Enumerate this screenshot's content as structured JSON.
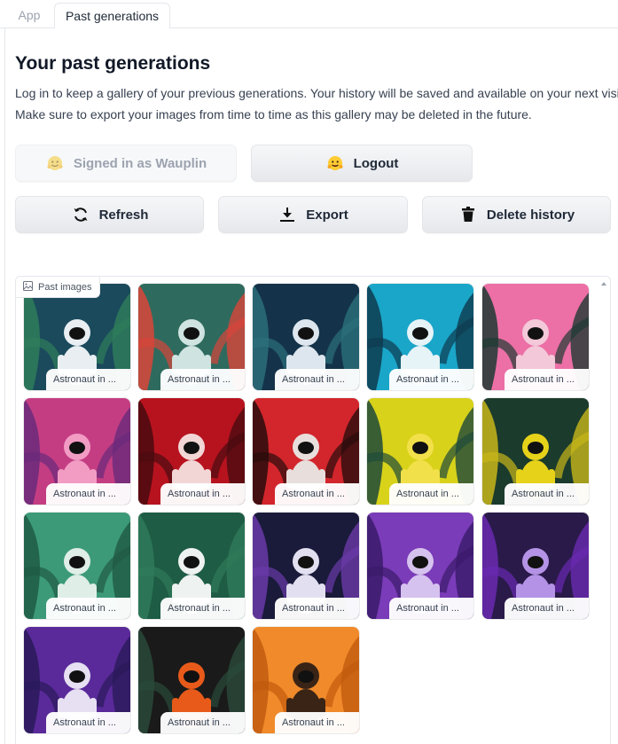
{
  "tabs": [
    {
      "label": "App"
    },
    {
      "label": "Past generations"
    }
  ],
  "page": {
    "title": "Your past generations",
    "description_line1": "Log in to keep a gallery of your previous generations. Your history will be saved and available on your next visit.",
    "description_line2": "Make sure to export your images from time to time as this gallery may be deleted in the future."
  },
  "buttons": {
    "signed_in": {
      "label": "Signed in as Wauplin",
      "icon": "hugging-face-icon"
    },
    "logout": {
      "label": "Logout",
      "icon": "hugging-face-icon"
    },
    "refresh": {
      "label": "Refresh",
      "icon": "refresh-icon"
    },
    "export": {
      "label": "Export",
      "icon": "download-icon"
    },
    "delete": {
      "label": "Delete history",
      "icon": "trash-icon"
    }
  },
  "gallery": {
    "label": "Past images",
    "icon": "image-icon",
    "items": [
      {
        "caption": "Astronaut in ...",
        "bg": "#1a4a5c",
        "accent": "#e8eef2",
        "leaf": "#2f7d5a"
      },
      {
        "caption": "Astronaut in ...",
        "bg": "#2e6b5e",
        "accent": "#cfe3e0",
        "leaf": "#d9453a"
      },
      {
        "caption": "Astronaut in ...",
        "bg": "#14334a",
        "accent": "#dde6ee",
        "leaf": "#2b6f7a"
      },
      {
        "caption": "Astronaut in ...",
        "bg": "#1aa6c9",
        "accent": "#e6f3f7",
        "leaf": "#0e3b4f"
      },
      {
        "caption": "Astronaut in ...",
        "bg": "#ec6fa6",
        "accent": "#f3c8d8",
        "leaf": "#1f3a33"
      },
      {
        "caption": "Astronaut in ...",
        "bg": "#c43d83",
        "accent": "#f29cc4",
        "leaf": "#6a2a7a"
      },
      {
        "caption": "Astronaut in ...",
        "bg": "#b7131f",
        "accent": "#f2d6d6",
        "leaf": "#4a0b0f"
      },
      {
        "caption": "Astronaut in ...",
        "bg": "#d2262c",
        "accent": "#e8dfdc",
        "leaf": "#2a0c0c"
      },
      {
        "caption": "Astronaut in ...",
        "bg": "#d8d21a",
        "accent": "#f2e04a",
        "leaf": "#1f4a3a"
      },
      {
        "caption": "Astronaut in ...",
        "bg": "#1b3b2c",
        "accent": "#e7d21a",
        "leaf": "#c8b61a"
      },
      {
        "caption": "Astronaut in ...",
        "bg": "#3c9a78",
        "accent": "#dfeee6",
        "leaf": "#1f5a44"
      },
      {
        "caption": "Astronaut in ...",
        "bg": "#1e5c45",
        "accent": "#eef2f0",
        "leaf": "#2f7a5a"
      },
      {
        "caption": "Astronaut in ...",
        "bg": "#1a1a3a",
        "accent": "#e2e0f0",
        "leaf": "#6a3aa8"
      },
      {
        "caption": "Astronaut in ...",
        "bg": "#7a3cb8",
        "accent": "#d6c2ee",
        "leaf": "#3a1a6a"
      },
      {
        "caption": "Astronaut in ...",
        "bg": "#2a1a4a",
        "accent": "#b493e6",
        "leaf": "#6a2ab0"
      },
      {
        "caption": "Astronaut in ...",
        "bg": "#5a2a9a",
        "accent": "#e6e0f2",
        "leaf": "#2a1a5a"
      },
      {
        "caption": "Astronaut in ...",
        "bg": "#1a1a1a",
        "accent": "#e85a1a",
        "leaf": "#2a4a3a"
      },
      {
        "caption": "Astronaut in ...",
        "bg": "#f08a2a",
        "accent": "#3a2416",
        "leaf": "#c25a0e"
      }
    ]
  }
}
